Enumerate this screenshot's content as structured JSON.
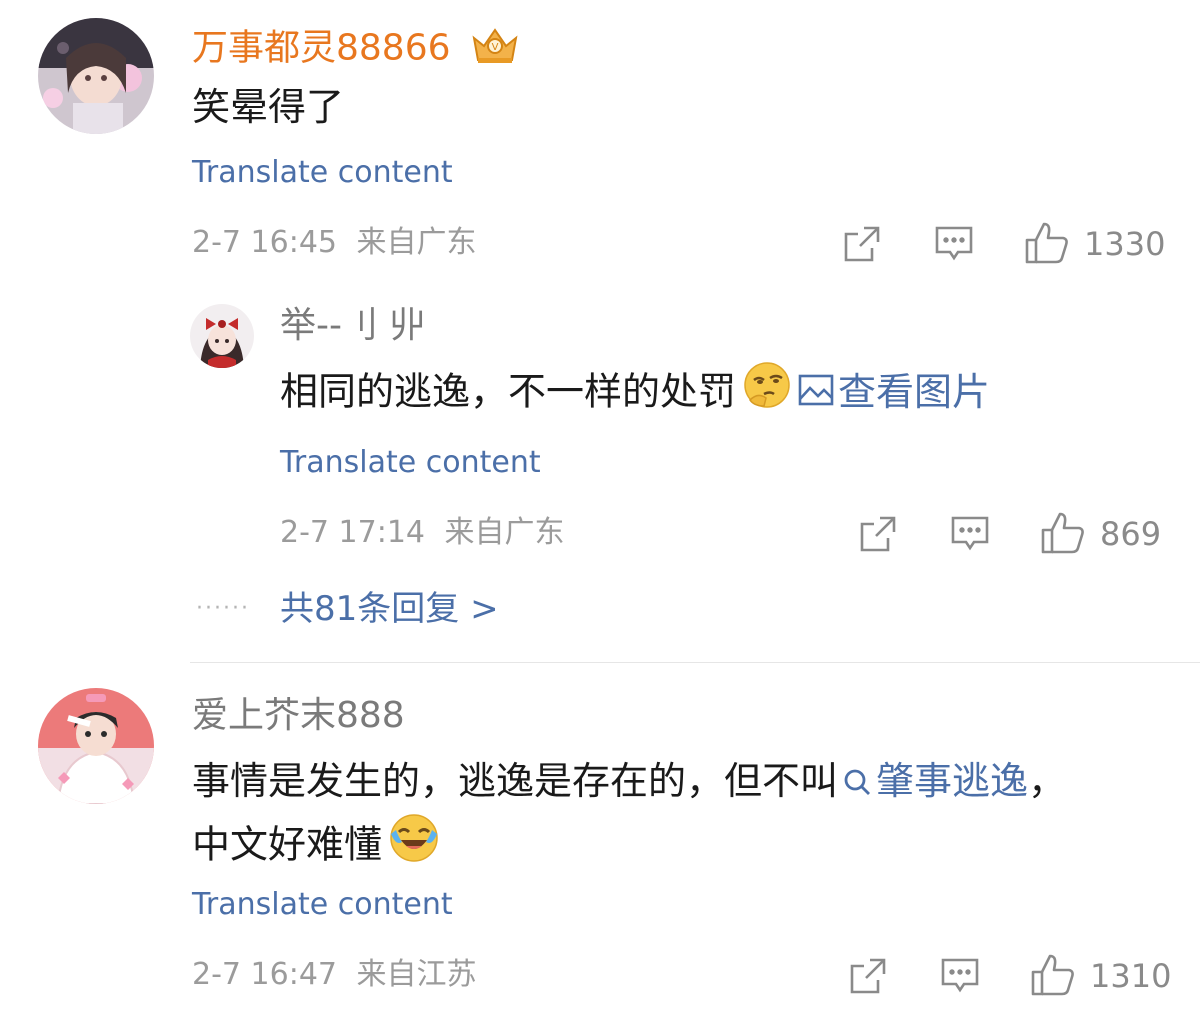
{
  "comments": [
    {
      "username": "万事都灵88866",
      "badge_icon": "crown-badge-icon",
      "text": "笑晕得了",
      "translate_label": "Translate content",
      "time": "2-7 16:45",
      "location": "来自广东",
      "likes": "1330",
      "reply": {
        "username": "举--刂 丱",
        "text": "相同的逃逸，不一样的处罚",
        "emoji_icon": "thinking-emoji-icon",
        "view_image_label": "查看图片",
        "translate_label": "Translate content",
        "time": "2-7 17:14",
        "location": "来自广东",
        "likes": "869"
      },
      "more_replies_label": "共81条回复 >",
      "dots": "······"
    },
    {
      "username": "爱上芥末888",
      "text_line1_a": "事情是发生的，逃逸是存在的，但不叫",
      "search_link": "肇事逃逸",
      "text_line1_b": "，",
      "text_line2": "中文好难懂",
      "emoji_icon": "laughing-crying-emoji-icon",
      "translate_label": "Translate content",
      "time": "2-7 16:47",
      "location": "来自江苏",
      "likes": "1310"
    }
  ],
  "colors": {
    "vip_name": "#e8771f",
    "link": "#4b6fa8",
    "meta": "#9b9b9b"
  }
}
